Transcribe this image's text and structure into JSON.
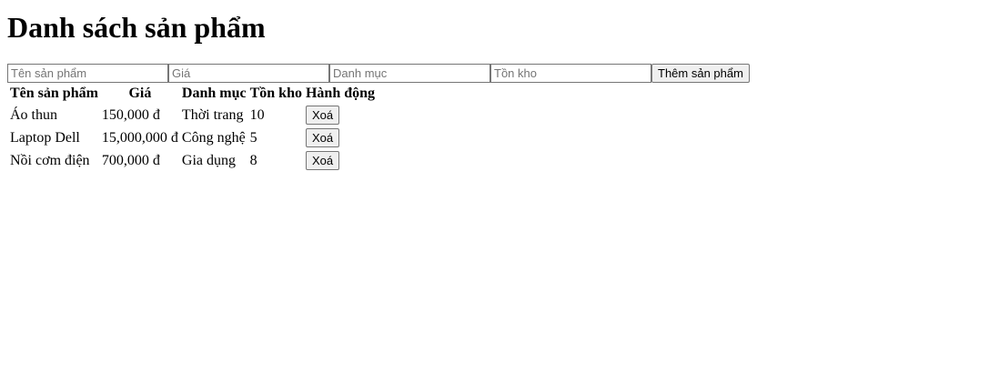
{
  "title": "Danh sách sản phẩm",
  "form": {
    "name_placeholder": "Tên sản phẩm",
    "price_placeholder": "Giá",
    "category_placeholder": "Danh mục",
    "stock_placeholder": "Tồn kho",
    "add_label": "Thêm sản phẩm"
  },
  "table": {
    "headers": [
      "Tên sản phẩm",
      "Giá",
      "Danh mục",
      "Tồn kho",
      "Hành động"
    ],
    "rows": [
      {
        "name": "Áo thun",
        "price": "150,000 đ",
        "category": "Thời trang",
        "stock": "10",
        "action": "Xoá"
      },
      {
        "name": "Laptop Dell",
        "price": "15,000,000 đ",
        "category": "Công nghệ",
        "stock": "5",
        "action": "Xoá"
      },
      {
        "name": "Nồi cơm điện",
        "price": "700,000 đ",
        "category": "Gia dụng",
        "stock": "8",
        "action": "Xoá"
      }
    ]
  }
}
